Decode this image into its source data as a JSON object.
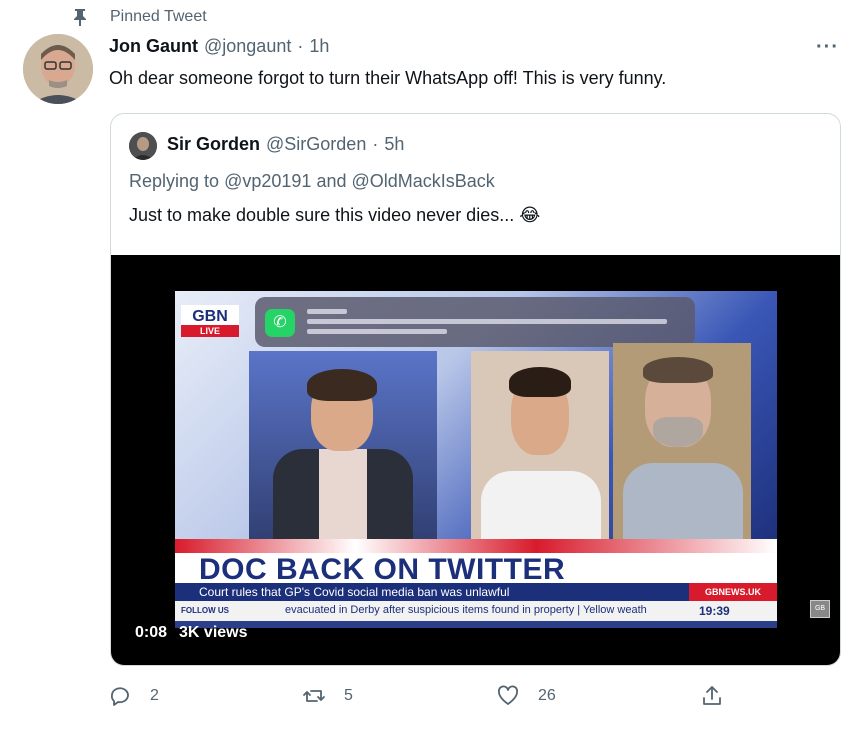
{
  "pinned": {
    "label": "Pinned Tweet"
  },
  "tweet": {
    "author_name": "Jon Gaunt",
    "author_handle": "@jongaunt",
    "separator": "·",
    "time": "1h",
    "text": "Oh dear someone forgot to turn their WhatsApp off! This is very funny.",
    "more_label": "···"
  },
  "quote": {
    "author_name": "Sir Gorden",
    "author_handle": "@SirGorden",
    "separator": "·",
    "time": "5h",
    "replying_prefix": "Replying to",
    "reply_to_1": "@vp20191",
    "reply_and": "and",
    "reply_to_2": "@OldMackIsBack",
    "text": "Just to make double sure this video never dies... 😂"
  },
  "video": {
    "duration": "0:08",
    "views": "3K views",
    "broadcast": {
      "logo": "GBN",
      "live": "LIVE",
      "headline": "DOC BACK ON TWITTER",
      "subline": "Court rules that GP's Covid social media ban was unlawful",
      "network_tag": "GBNEWS.UK",
      "follow_label": "FOLLOW US",
      "ticker": "evacuated in Derby after suspicious items found in property | Yellow weath",
      "clock": "19:39",
      "corner_badge": "GB"
    }
  },
  "actions": {
    "reply_count": "2",
    "retweet_count": "5",
    "like_count": "26"
  },
  "colors": {
    "text_primary": "#0f1419",
    "text_secondary": "#536471",
    "border": "#cfd9de",
    "gb_blue": "#1c2f7a",
    "gb_red": "#d81b2c"
  }
}
